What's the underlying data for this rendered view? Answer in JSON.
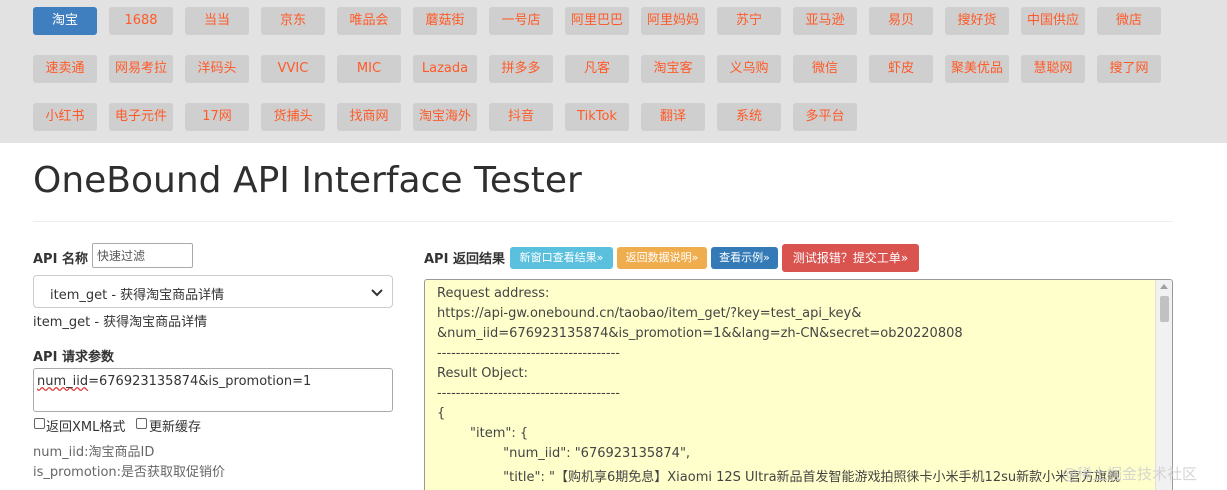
{
  "platforms": [
    {
      "label": "淘宝",
      "active": true
    },
    {
      "label": "1688"
    },
    {
      "label": "当当"
    },
    {
      "label": "京东"
    },
    {
      "label": "唯品会"
    },
    {
      "label": "蘑菇街"
    },
    {
      "label": "一号店"
    },
    {
      "label": "阿里巴巴"
    },
    {
      "label": "阿里妈妈"
    },
    {
      "label": "苏宁"
    },
    {
      "label": "亚马逊"
    },
    {
      "label": "易贝"
    },
    {
      "label": "搜好货"
    },
    {
      "label": "中国供应"
    },
    {
      "label": "微店"
    },
    {
      "label": "速卖通"
    },
    {
      "label": "网易考拉"
    },
    {
      "label": "洋码头"
    },
    {
      "label": "VVIC"
    },
    {
      "label": "MIC"
    },
    {
      "label": "Lazada"
    },
    {
      "label": "拼多多"
    },
    {
      "label": "凡客"
    },
    {
      "label": "淘宝客"
    },
    {
      "label": "义乌购"
    },
    {
      "label": "微信"
    },
    {
      "label": "虾皮"
    },
    {
      "label": "聚美优品"
    },
    {
      "label": "慧聪网"
    },
    {
      "label": "搜了网"
    },
    {
      "label": "小红书"
    },
    {
      "label": "电子元件"
    },
    {
      "label": "17网"
    },
    {
      "label": "货捕头"
    },
    {
      "label": "找商网"
    },
    {
      "label": "淘宝海外"
    },
    {
      "label": "抖音"
    },
    {
      "label": "TikTok"
    },
    {
      "label": "翻译"
    },
    {
      "label": "系统"
    },
    {
      "label": "多平台"
    }
  ],
  "page_title": "OneBound API Interface Tester",
  "left": {
    "api_name_label": "API 名称",
    "filter_placeholder": "快速过滤",
    "api_selected": "item_get - 获得淘宝商品详情",
    "api_desc": "item_get - 获得淘宝商品详情",
    "params_label": "API 请求参数",
    "params_value_prefix": "num_iid",
    "params_value_rest": "=676923135874&is_promotion=1",
    "xml_checkbox_label": "返回XML格式",
    "cache_checkbox_label": "更新缓存",
    "hint_1": "num_iid:淘宝商品ID",
    "hint_2": "is_promotion:是否获取取促销价"
  },
  "right": {
    "result_label": "API 返回结果",
    "btn_new_window": "新窗口查看结果»",
    "btn_return_doc": "返回数据说明»",
    "btn_example": "查看示例»",
    "btn_report": "测试报错？提交工单»",
    "result_lines": [
      "Request address:",
      "https://api-gw.onebound.cn/taobao/item_get/?key=test_api_key&",
      "&num_iid=676923135874&is_promotion=1&&lang=zh-CN&secret=ob20220808",
      "---------------------------------------",
      "Result Object:",
      "---------------------------------------",
      "{",
      "        \"item\": {",
      "                \"num_iid\": \"676923135874\",",
      "                \"title\": \"【购机享6期免息】Xiaomi 12S Ultra新品首发智能游戏拍照徕卡小米手机12su新款小米官方旗舰"
    ]
  },
  "watermark": "@稀土掘金技术社区",
  "colors": {
    "nav_bg": "#e2e2e2",
    "nav_btn": "#cfcfcf",
    "nav_text": "#ff5a28",
    "active_btn": "#3f7fc0",
    "btn_new_window": "#5bc0de",
    "btn_return_doc": "#f0ad4e",
    "btn_example": "#337ab7",
    "btn_report": "#d9534f",
    "result_bg": "#ffffcc"
  }
}
